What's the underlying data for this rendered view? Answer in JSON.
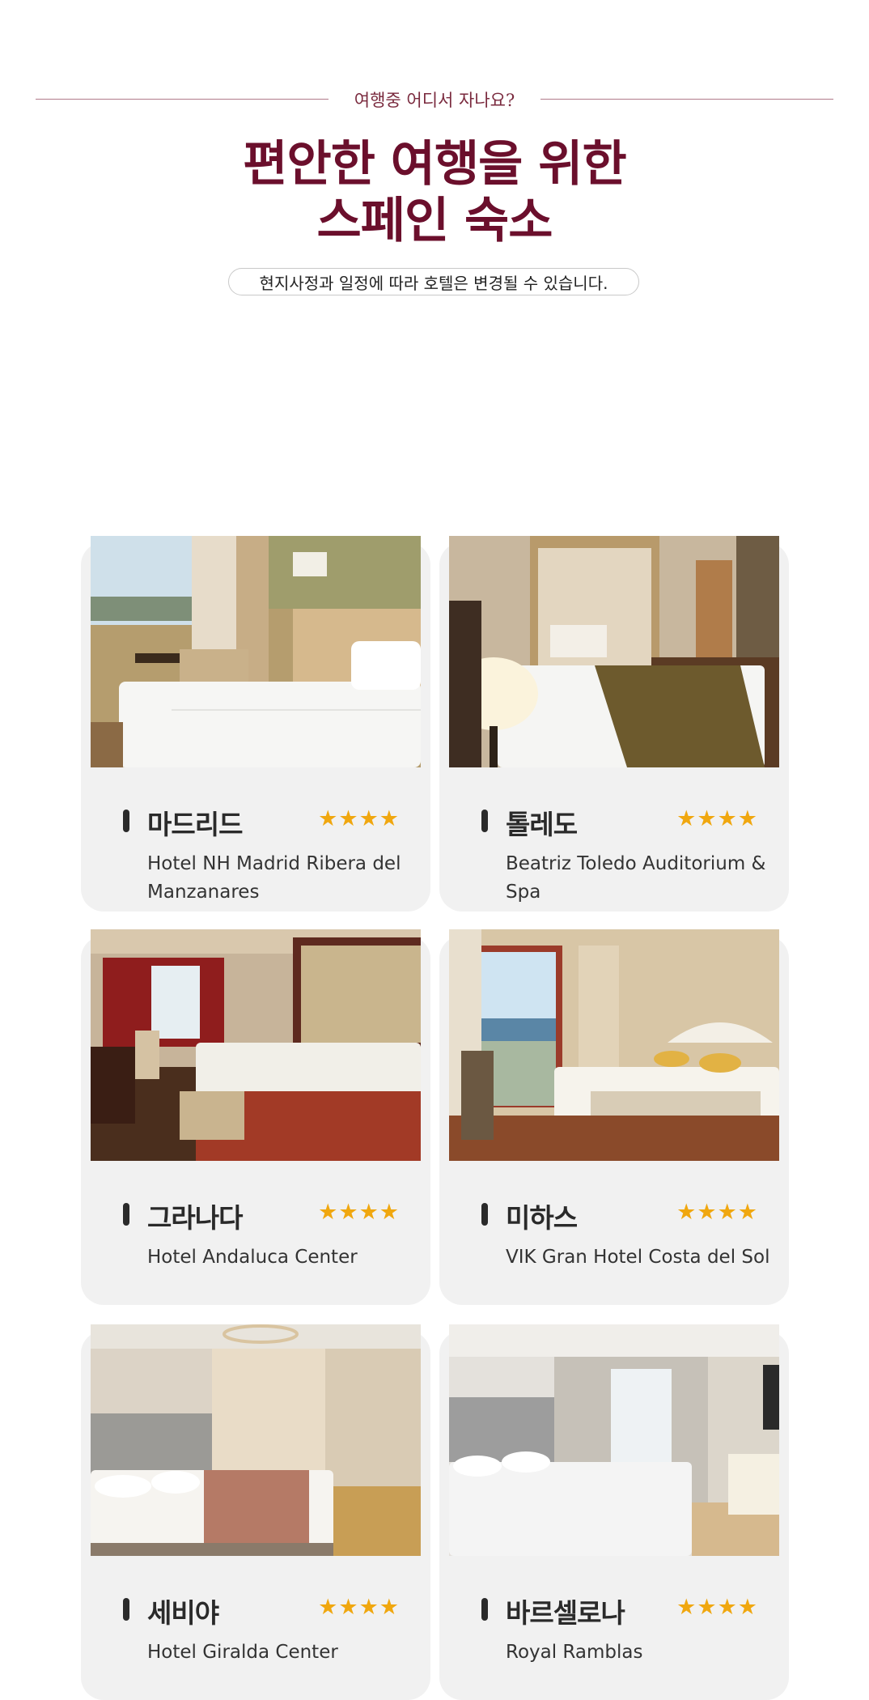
{
  "header": {
    "eyebrow": "여행중 어디서 자나요?",
    "title_line1": "편안한 여행을 위한",
    "title_line2": "스페인 숙소",
    "notice": "현지사정과 일정에 따라 호텔은 변경될 수 있습니다."
  },
  "hotels": [
    {
      "city": "마드리드",
      "name": "Hotel NH Madrid Ribera del Manzanares",
      "stars": "★★★★",
      "rating": 4
    },
    {
      "city": "톨레도",
      "name": "Beatriz Toledo Auditorium & Spa",
      "stars": "★★★★",
      "rating": 4
    },
    {
      "city": "그라나다",
      "name": "Hotel Andaluca Center",
      "stars": "★★★★",
      "rating": 4
    },
    {
      "city": "미하스",
      "name": "VIK Gran Hotel Costa del Sol",
      "stars": "★★★★",
      "rating": 4
    },
    {
      "city": "세비야",
      "name": "Hotel Giralda Center",
      "stars": "★★★★",
      "rating": 4
    },
    {
      "city": "바르셀로나",
      "name": "Royal Ramblas",
      "stars": "★★★★",
      "rating": 4
    }
  ],
  "colors": {
    "accent": "#6b0f2c",
    "star": "#f0a70f",
    "card_bg": "#f1f1f1"
  }
}
